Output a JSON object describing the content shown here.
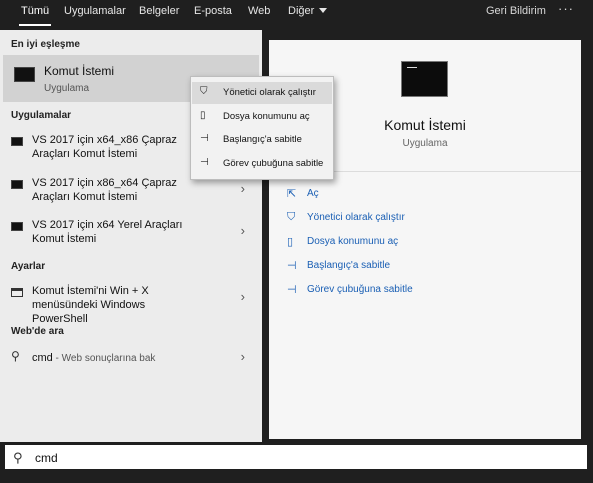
{
  "tabs": [
    {
      "label": "Tümü",
      "active": true
    },
    {
      "label": "Uygulamalar"
    },
    {
      "label": "Belgeler"
    },
    {
      "label": "E-posta"
    },
    {
      "label": "Web"
    },
    {
      "label": "Diğer"
    }
  ],
  "topbar": {
    "feedback": "Geri Bildirim",
    "more": "···"
  },
  "left": {
    "best_match_header": "En iyi eşleşme",
    "best_match": {
      "title": "Komut İstemi",
      "subtitle": "Uygulama",
      "icon": "command-prompt-icon"
    },
    "apps_header": "Uygulamalar",
    "apps": [
      {
        "label": "VS 2017 için x64_x86 Çapraz Araçları Komut İstemi"
      },
      {
        "label": "VS 2017 için x86_x64 Çapraz Araçları Komut İstemi"
      },
      {
        "label": "VS 2017 için x64 Yerel Araçları Komut İstemi"
      }
    ],
    "settings_header": "Ayarlar",
    "settings": [
      {
        "label": "Komut İstemi'ni Win + X menüsündeki Windows PowerShell"
      }
    ],
    "web_header": "Web'de ara",
    "web": {
      "query": "cmd",
      "hint": " - Web sonuçlarına bak"
    }
  },
  "context_menu": [
    {
      "label": "Yönetici olarak çalıştır",
      "icon": "shield-icon",
      "highlighted": true
    },
    {
      "label": "Dosya konumunu aç",
      "icon": "folder-icon"
    },
    {
      "label": "Başlangıç'a sabitle",
      "icon": "pin-icon"
    },
    {
      "label": "Görev çubuğuna sabitle",
      "icon": "pin-icon"
    }
  ],
  "detail": {
    "name": "Komut İstemi",
    "type": "Uygulama",
    "actions": [
      {
        "label": "Aç",
        "icon": "open-icon"
      },
      {
        "label": "Yönetici olarak çalıştır",
        "icon": "shield-icon"
      },
      {
        "label": "Dosya konumunu aç",
        "icon": "folder-icon"
      },
      {
        "label": "Başlangıç'a sabitle",
        "icon": "pin-icon"
      },
      {
        "label": "Görev çubuğuna sabitle",
        "icon": "pin-icon"
      }
    ]
  },
  "search": {
    "value": "cmd"
  },
  "colors": {
    "accent": "#1a5fb4",
    "topbar": "#1f1f1f",
    "panel": "#ececec"
  }
}
